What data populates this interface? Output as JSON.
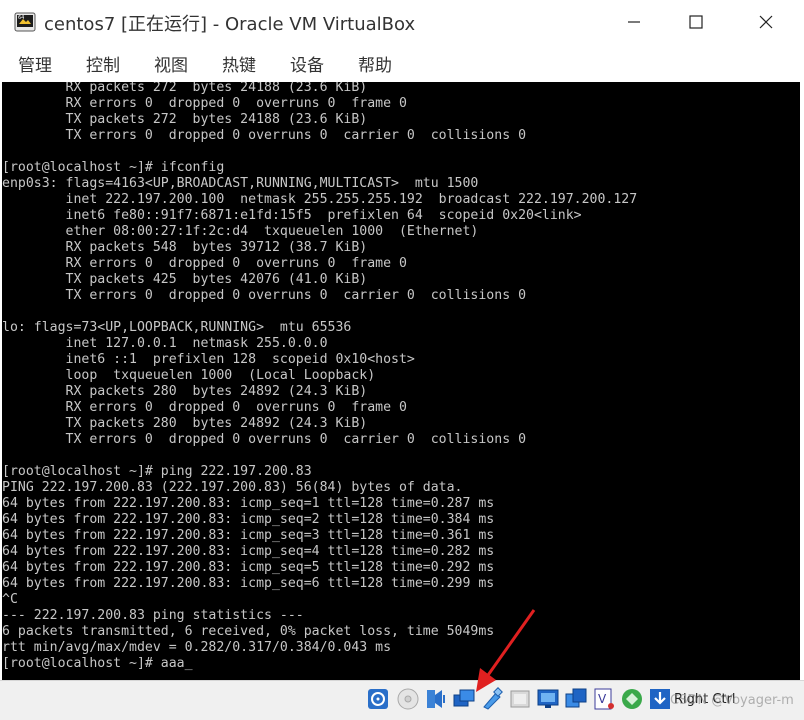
{
  "window": {
    "title": "centos7 [正在运行] - Oracle VM VirtualBox"
  },
  "menu": {
    "items": [
      "管理",
      "控制",
      "视图",
      "热键",
      "设备",
      "帮助"
    ]
  },
  "console": {
    "lines": [
      "        RX packets 272  bytes 24188 (23.6 KiB)",
      "        RX errors 0  dropped 0  overruns 0  frame 0",
      "        TX packets 272  bytes 24188 (23.6 KiB)",
      "        TX errors 0  dropped 0 overruns 0  carrier 0  collisions 0",
      "",
      "[root@localhost ~]# ifconfig",
      "enp0s3: flags=4163<UP,BROADCAST,RUNNING,MULTICAST>  mtu 1500",
      "        inet 222.197.200.100  netmask 255.255.255.192  broadcast 222.197.200.127",
      "        inet6 fe80::91f7:6871:e1fd:15f5  prefixlen 64  scopeid 0x20<link>",
      "        ether 08:00:27:1f:2c:d4  txqueuelen 1000  (Ethernet)",
      "        RX packets 548  bytes 39712 (38.7 KiB)",
      "        RX errors 0  dropped 0  overruns 0  frame 0",
      "        TX packets 425  bytes 42076 (41.0 KiB)",
      "        TX errors 0  dropped 0 overruns 0  carrier 0  collisions 0",
      "",
      "lo: flags=73<UP,LOOPBACK,RUNNING>  mtu 65536",
      "        inet 127.0.0.1  netmask 255.0.0.0",
      "        inet6 ::1  prefixlen 128  scopeid 0x10<host>",
      "        loop  txqueuelen 1000  (Local Loopback)",
      "        RX packets 280  bytes 24892 (24.3 KiB)",
      "        RX errors 0  dropped 0  overruns 0  frame 0",
      "        TX packets 280  bytes 24892 (24.3 KiB)",
      "        TX errors 0  dropped 0 overruns 0  carrier 0  collisions 0",
      "",
      "[root@localhost ~]# ping 222.197.200.83",
      "PING 222.197.200.83 (222.197.200.83) 56(84) bytes of data.",
      "64 bytes from 222.197.200.83: icmp_seq=1 ttl=128 time=0.287 ms",
      "64 bytes from 222.197.200.83: icmp_seq=2 ttl=128 time=0.384 ms",
      "64 bytes from 222.197.200.83: icmp_seq=3 ttl=128 time=0.361 ms",
      "64 bytes from 222.197.200.83: icmp_seq=4 ttl=128 time=0.282 ms",
      "64 bytes from 222.197.200.83: icmp_seq=5 ttl=128 time=0.292 ms",
      "64 bytes from 222.197.200.83: icmp_seq=6 ttl=128 time=0.299 ms",
      "^C",
      "--- 222.197.200.83 ping statistics ---",
      "6 packets transmitted, 6 received, 0% packet loss, time 5049ms",
      "rtt min/avg/max/mdev = 0.282/0.317/0.384/0.043 ms",
      "[root@localhost ~]# aaa_"
    ]
  },
  "statusbar": {
    "icons": [
      "optical-disk-icon",
      "floppy-icon",
      "audio-icon",
      "network-icon",
      "usb-icon",
      "shared-folder-icon",
      "display-icon",
      "vm-windows-icon",
      "video-capture-icon",
      "cpu-icon",
      "mouse-integration-icon",
      "download-icon"
    ],
    "host_key": "Right Ctrl",
    "watermark": "CSDN @Voyager-m"
  },
  "colors": {
    "console_bg": "#000000",
    "console_fg": "#c7c7c7",
    "annotation_arrow": "#e02020"
  }
}
